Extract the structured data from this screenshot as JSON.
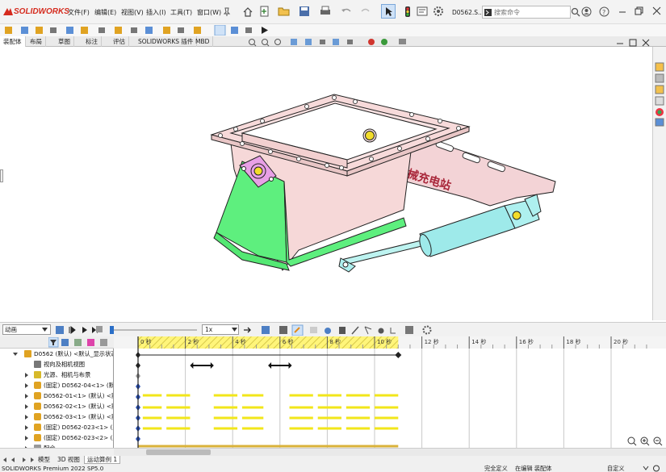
{
  "app": {
    "logo": "SOLIDWORKS",
    "document": "D0562.S...",
    "search_placeholder": "搜索命令"
  },
  "menus": [
    "文件(F)",
    "编辑(E)",
    "视图(V)",
    "插入(I)",
    "工具(T)",
    "窗口(W)"
  ],
  "tabs": [
    "装配体",
    "布局",
    "草图",
    "标注",
    "评估",
    "SOLIDWORKS 插件",
    "MBD"
  ],
  "active_tab": "装配体",
  "watermark": "机械充电站",
  "motion": {
    "study_type": "动画",
    "playback_speed": "1x",
    "playhead_seconds": 0
  },
  "timeline": {
    "tick_labels": [
      "0 秒",
      "2 秒",
      "4 秒",
      "6 秒",
      "8 秒",
      "10 秒",
      "12 秒",
      "14 秒",
      "16 秒",
      "18 秒",
      "20 秒"
    ],
    "duration_seconds": 11
  },
  "tree": [
    {
      "label": "D0562 (默认) <默认_显示状态",
      "indent": 0,
      "icon": "assembly-icon"
    },
    {
      "label": "视向及相机视图",
      "indent": 1,
      "icon": "camera-icon"
    },
    {
      "label": "光源、相机与布景",
      "indent": 1,
      "icon": "light-icon"
    },
    {
      "label": "(固定) D0562-04<1> (默认",
      "indent": 1,
      "icon": "part-icon"
    },
    {
      "label": "D0562-01<1> (默认) <默",
      "indent": 1,
      "icon": "part-icon"
    },
    {
      "label": "D0562-02<1> (默认) <默",
      "indent": 1,
      "icon": "part-icon"
    },
    {
      "label": "D0562-03<1> (默认) <默",
      "indent": 1,
      "icon": "part-icon"
    },
    {
      "label": "(固定) D0562-023<1> (默",
      "indent": 1,
      "icon": "part-icon"
    },
    {
      "label": "(固定) D0562-023<2> (默",
      "indent": 1,
      "icon": "part-icon"
    },
    {
      "label": "配合",
      "indent": 1,
      "icon": "mate-icon"
    }
  ],
  "bottom_tabs": [
    "模型",
    "3D 视图",
    "运动算例 1"
  ],
  "active_bottom_tab": "运动算例 1",
  "status": {
    "version": "SOLIDWORKS Premium 2022 SP5.0",
    "definition": "完全定义",
    "mode": "在编辑 装配体",
    "units": "自定义"
  }
}
